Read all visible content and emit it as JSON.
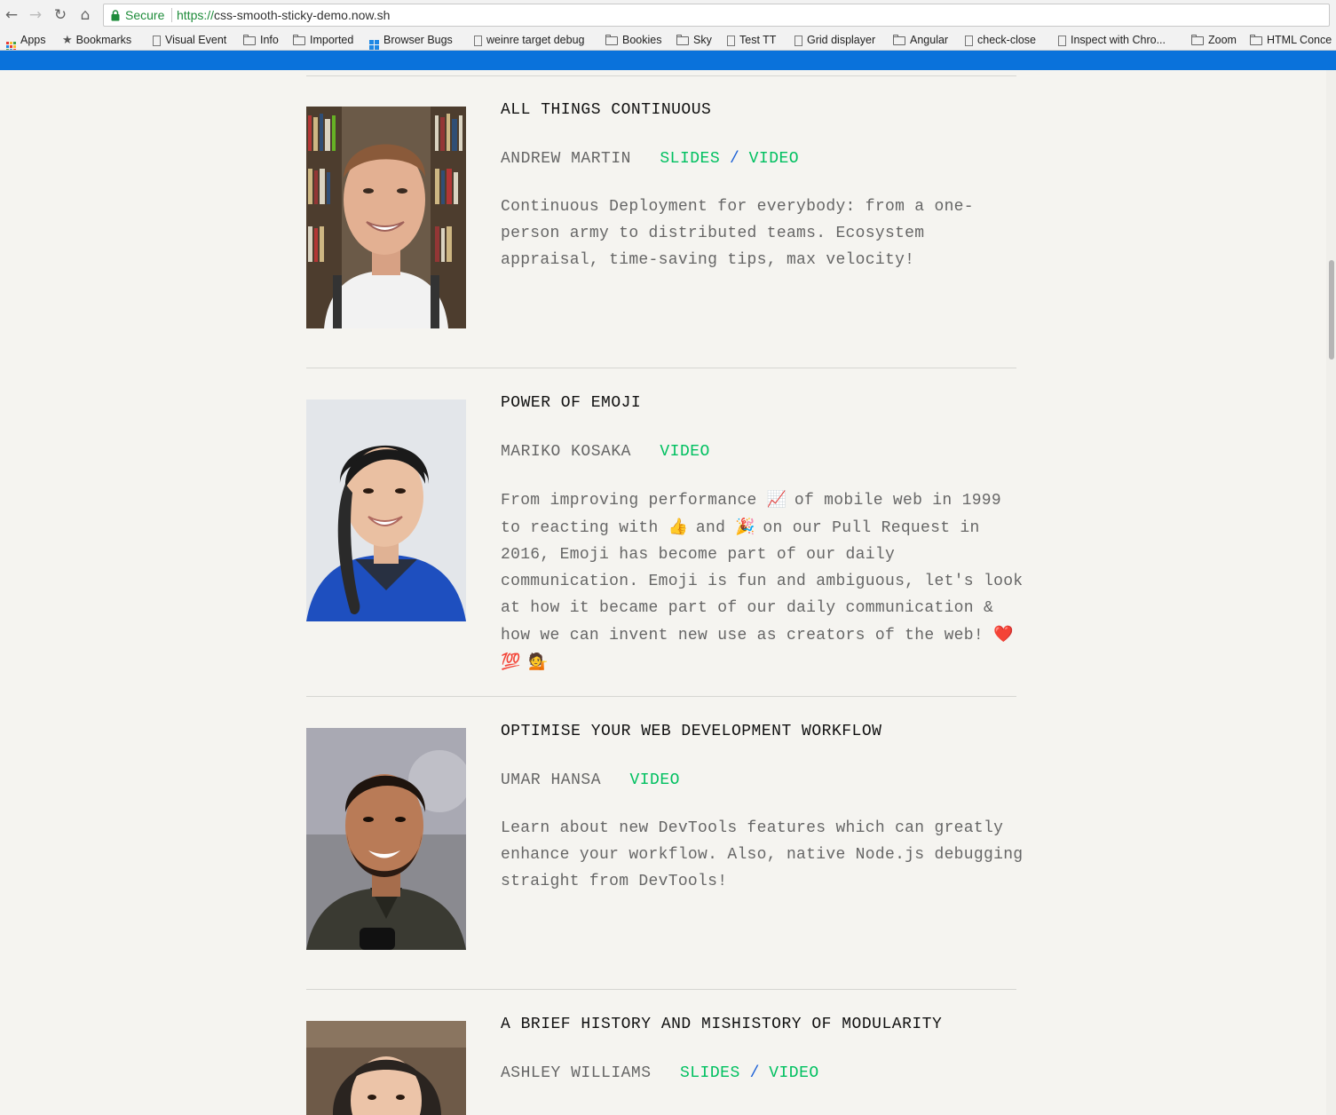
{
  "browser": {
    "secure_label": "Secure",
    "url_scheme": "https://",
    "url_host": "css-smooth-sticky-demo.now.sh",
    "bookmarks": [
      {
        "label": "Apps",
        "icon": "apps-icon"
      },
      {
        "label": "Bookmarks",
        "icon": "star-icon"
      },
      {
        "label": "Visual Event",
        "icon": "page-icon"
      },
      {
        "label": "Info",
        "icon": "folder-icon"
      },
      {
        "label": "Imported",
        "icon": "folder-icon"
      },
      {
        "label": "Browser Bugs",
        "icon": "windows-icon"
      },
      {
        "label": "weinre target debug",
        "icon": "page-icon"
      },
      {
        "label": "Bookies",
        "icon": "folder-icon"
      },
      {
        "label": "Sky",
        "icon": "folder-icon"
      },
      {
        "label": "Test TT",
        "icon": "page-icon"
      },
      {
        "label": "Grid displayer",
        "icon": "page-icon"
      },
      {
        "label": "Angular",
        "icon": "folder-icon"
      },
      {
        "label": "check-close",
        "icon": "page-icon"
      },
      {
        "label": "Inspect with Chro...",
        "icon": "page-icon"
      },
      {
        "label": "Zoom",
        "icon": "folder-icon"
      },
      {
        "label": "HTML Conce",
        "icon": "folder-icon"
      }
    ],
    "accent_color": "#0a72db"
  },
  "talks": [
    {
      "title": "ALL THINGS CONTINUOUS",
      "speaker": "ANDREW MARTIN",
      "slides": "SLIDES",
      "separator": "/",
      "video": "VIDEO",
      "description": "Continuous Deployment for everybody: from a one-person army to distributed teams. Ecosystem appraisal, time-saving tips, max velocity!"
    },
    {
      "title": "POWER OF EMOJI",
      "speaker": "MARIKO KOSAKA",
      "video": "VIDEO",
      "desc_lines": [
        "From improving performance",
        "📈",
        "of mobile web in 1999",
        "to reacting with",
        "👍",
        "and",
        "🎉",
        "on our Pull Request in",
        "2016, Emoji has become part of our daily communication. Emoji is fun and ambiguous, let's look at how it became part of our daily communication & how we can invent new use as creators of the web!",
        "❤️",
        "💯",
        "💁"
      ]
    },
    {
      "title": "OPTIMISE YOUR WEB DEVELOPMENT WORKFLOW",
      "speaker": "UMAR HANSA",
      "video": "VIDEO",
      "description": "Learn about new DevTools features which can greatly enhance your workflow. Also, native Node.js debugging straight from DevTools!"
    },
    {
      "title": "A BRIEF HISTORY AND MISHISTORY OF MODULARITY",
      "speaker": "ASHLEY WILLIAMS",
      "slides": "SLIDES",
      "separator": "/",
      "video": "VIDEO"
    }
  ],
  "colors": {
    "link": "#00c060",
    "slash": "#1a5fd6",
    "background": "#f5f4f0"
  }
}
